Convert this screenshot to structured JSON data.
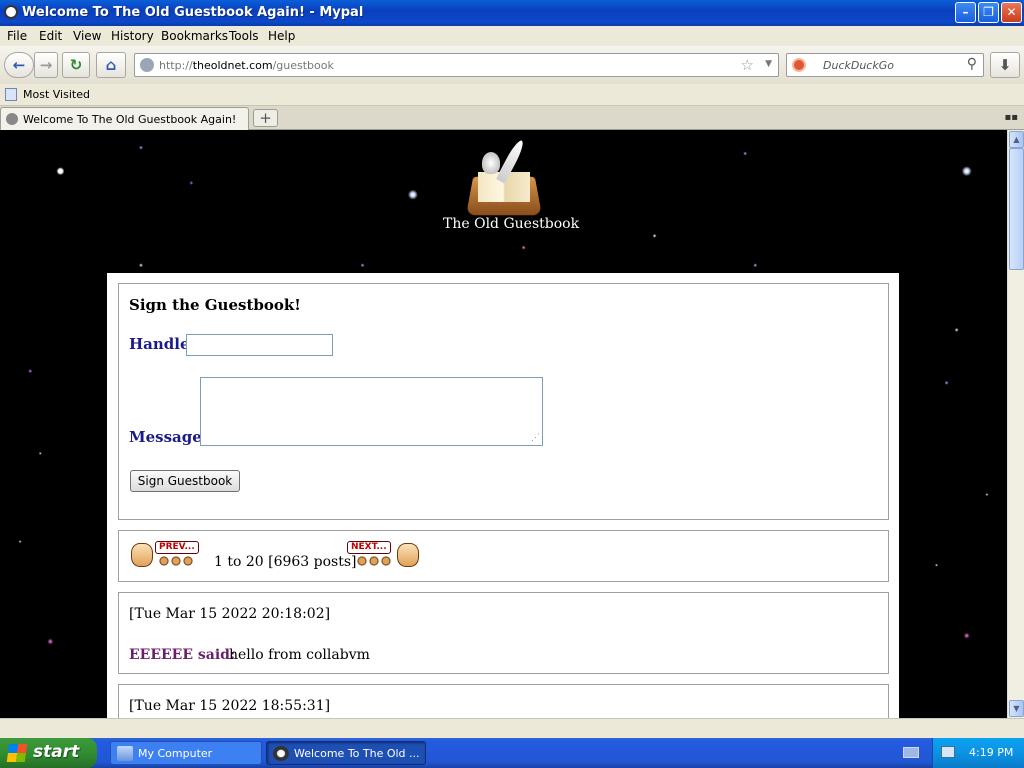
{
  "window": {
    "title": "Welcome To The Old Guestbook Again! - Mypal",
    "min_label": "–",
    "max_label": "❐",
    "close_label": "✕"
  },
  "menu": {
    "items": [
      "File",
      "Edit",
      "View",
      "History",
      "Bookmarks",
      "Tools",
      "Help"
    ]
  },
  "navbar": {
    "url_prefix": "http://",
    "url_domain": "theoldnet.com",
    "url_path": "/guestbook",
    "search_placeholder": "DuckDuckGo",
    "back_icon": "←",
    "forward_icon": "→",
    "reload_icon": "↻",
    "home_icon": "⌂",
    "star_icon": "☆",
    "drop_icon": "▼",
    "search_icon": "⚲",
    "download_icon": "⬇"
  },
  "bookmarks": {
    "most_visited": "Most Visited"
  },
  "tabs": {
    "items": [
      {
        "label": "Welcome To The Old Guestbook Again!"
      }
    ],
    "new_tab_label": "+",
    "list_icon": "▪▪"
  },
  "page": {
    "site_name": "The Old Guestbook",
    "form": {
      "heading": "Sign the Guestbook!",
      "handle_label": "Handle:",
      "handle_value": "",
      "message_label": "Message:",
      "message_value": "",
      "submit_label": "Sign Guestbook"
    },
    "pager": {
      "prev_label": "PREV...",
      "next_label": "NEXT...",
      "range_text": "1 to 20 [6963 posts]"
    },
    "posts": [
      {
        "date": "[Tue Mar 15 2022 20:18:02]",
        "author": "EEEEEE",
        "said": "said:",
        "message": "hello from collabvm"
      },
      {
        "date": "[Tue Mar 15 2022 18:55:31]"
      }
    ]
  },
  "taskbar": {
    "start_label": "start",
    "items": [
      {
        "label": "My Computer"
      },
      {
        "label": "Welcome To The Old ..."
      }
    ],
    "clock": "4:19 PM"
  },
  "colors": {
    "titlebar_blue": "#0a5fd8",
    "label_blue": "#1a1a8a",
    "author_purple": "#6b1f6b",
    "pager_red": "#c00000",
    "start_green": "#2f8a2f"
  }
}
